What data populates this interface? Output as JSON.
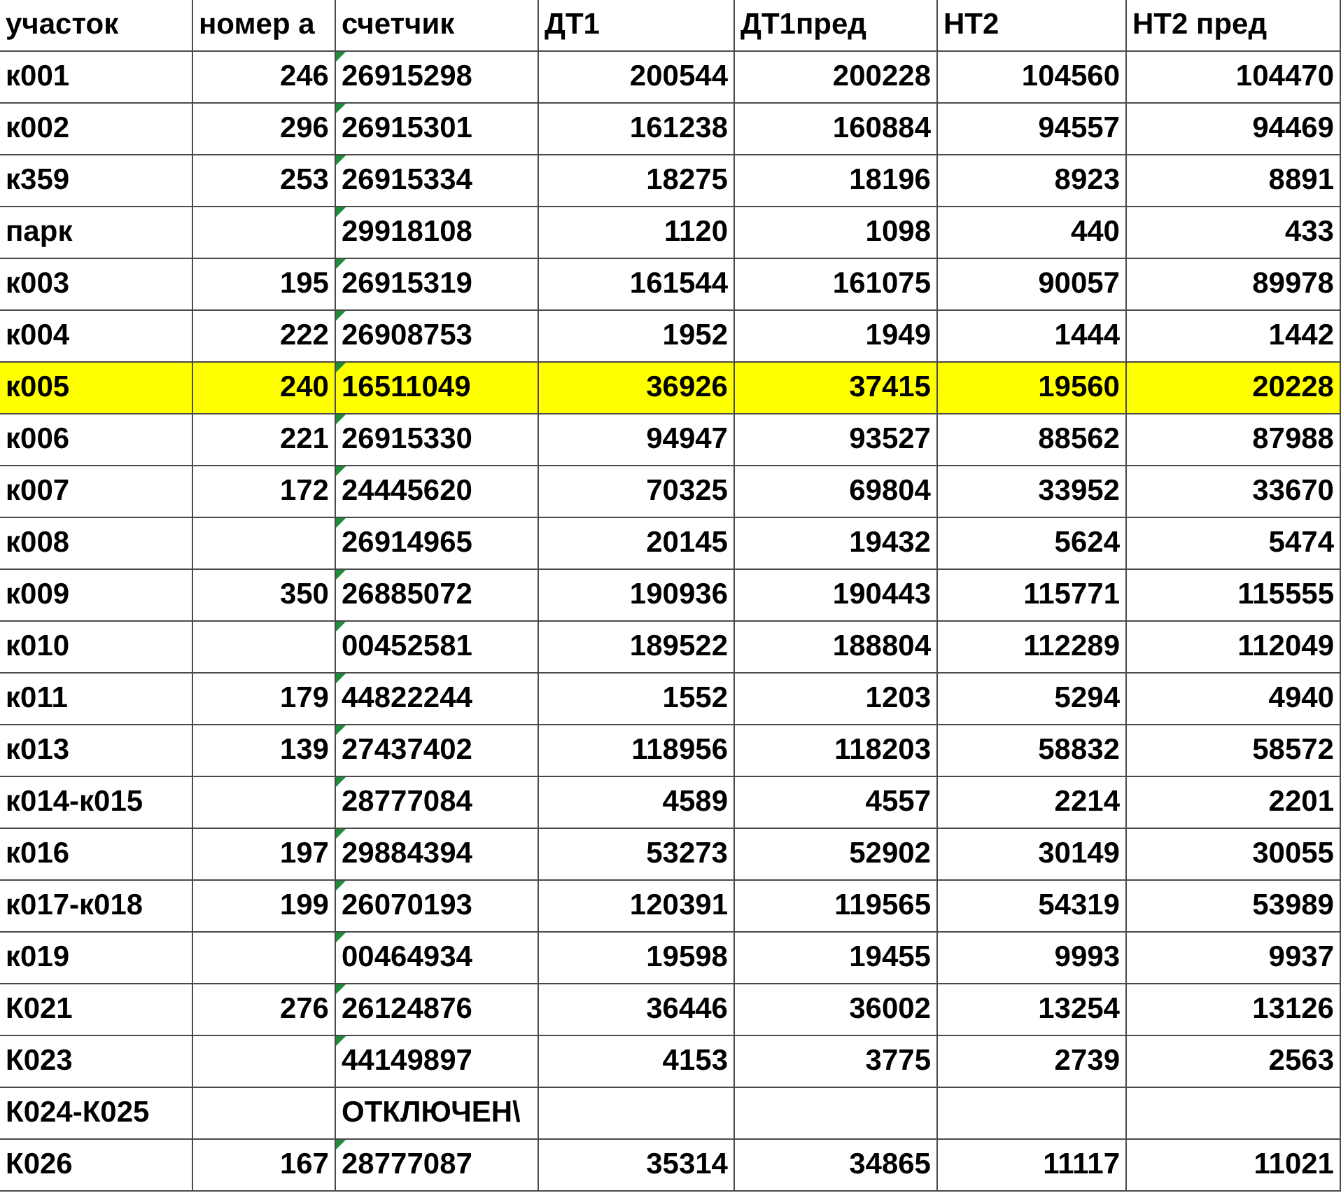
{
  "table": {
    "columns": [
      "участок",
      "номер а",
      "счетчик",
      "ДТ1",
      "ДТ1пред",
      "НТ2",
      "НТ2 пред"
    ],
    "rows": [
      {
        "plot": "к001",
        "number": "246",
        "meter": "26915298",
        "dt1": "200544",
        "dt1_prev": "200228",
        "nt2": "104560",
        "nt2_prev": "104470",
        "highlighted": false,
        "flagged": true
      },
      {
        "plot": "к002",
        "number": "296",
        "meter": "26915301",
        "dt1": "161238",
        "dt1_prev": "160884",
        "nt2": "94557",
        "nt2_prev": "94469",
        "highlighted": false,
        "flagged": true
      },
      {
        "plot": "к359",
        "number": "253",
        "meter": "26915334",
        "dt1": "18275",
        "dt1_prev": "18196",
        "nt2": "8923",
        "nt2_prev": "8891",
        "highlighted": false,
        "flagged": true
      },
      {
        "plot": "парк",
        "meter": "29918108",
        "dt1": "1120",
        "dt1_prev": "1098",
        "nt2": "440",
        "nt2_prev": "433",
        "highlighted": false,
        "flagged": true
      },
      {
        "plot": "к003",
        "number": "195",
        "meter": "26915319",
        "dt1": "161544",
        "dt1_prev": "161075",
        "nt2": "90057",
        "nt2_prev": "89978",
        "highlighted": false,
        "flagged": true
      },
      {
        "plot": "к004",
        "number": "222",
        "meter": "26908753",
        "dt1": "1952",
        "dt1_prev": "1949",
        "nt2": "1444",
        "nt2_prev": "1442",
        "highlighted": false,
        "flagged": true
      },
      {
        "plot": "к005",
        "number": "240",
        "meter": "16511049",
        "dt1": "36926",
        "dt1_prev": "37415",
        "nt2": "19560",
        "nt2_prev": "20228",
        "highlighted": true,
        "flagged": true
      },
      {
        "plot": "к006",
        "number": "221",
        "meter": "26915330",
        "dt1": "94947",
        "dt1_prev": "93527",
        "nt2": "88562",
        "nt2_prev": "87988",
        "highlighted": false,
        "flagged": true
      },
      {
        "plot": "к007",
        "number": "172",
        "meter": "24445620",
        "dt1": "70325",
        "dt1_prev": "69804",
        "nt2": "33952",
        "nt2_prev": "33670",
        "highlighted": false,
        "flagged": true
      },
      {
        "plot": "к008",
        "meter": "26914965",
        "dt1": "20145",
        "dt1_prev": "19432",
        "nt2": "5624",
        "nt2_prev": "5474",
        "highlighted": false,
        "flagged": true
      },
      {
        "plot": "к009",
        "number": "350",
        "meter": "26885072",
        "dt1": "190936",
        "dt1_prev": "190443",
        "nt2": "115771",
        "nt2_prev": "115555",
        "highlighted": false,
        "flagged": true
      },
      {
        "plot": "к010",
        "meter": "00452581",
        "dt1": "189522",
        "dt1_prev": "188804",
        "nt2": "112289",
        "nt2_prev": "112049",
        "highlighted": false,
        "flagged": true
      },
      {
        "plot": "к011",
        "number": "179",
        "meter": "44822244",
        "dt1": "1552",
        "dt1_prev": "1203",
        "nt2": "5294",
        "nt2_prev": "4940",
        "highlighted": false,
        "flagged": true
      },
      {
        "plot": "к013",
        "number": "139",
        "meter": "27437402",
        "dt1": "118956",
        "dt1_prev": "118203",
        "nt2": "58832",
        "nt2_prev": "58572",
        "highlighted": false,
        "flagged": true
      },
      {
        "plot": "к014-к015",
        "meter": "28777084",
        "dt1": "4589",
        "dt1_prev": "4557",
        "nt2": "2214",
        "nt2_prev": "2201",
        "highlighted": false,
        "flagged": true
      },
      {
        "plot": "к016",
        "number": "197",
        "meter": "29884394",
        "dt1": "53273",
        "dt1_prev": "52902",
        "nt2": "30149",
        "nt2_prev": "30055",
        "highlighted": false,
        "flagged": true
      },
      {
        "plot": "к017-к018",
        "number": "199",
        "meter": "26070193",
        "dt1": "120391",
        "dt1_prev": "119565",
        "nt2": "54319",
        "nt2_prev": "53989",
        "highlighted": false,
        "flagged": true
      },
      {
        "plot": "к019",
        "meter": "00464934",
        "dt1": "19598",
        "dt1_prev": "19455",
        "nt2": "9993",
        "nt2_prev": "9937",
        "highlighted": false,
        "flagged": true
      },
      {
        "plot": "К021",
        "number": "276",
        "meter": "26124876",
        "dt1": "36446",
        "dt1_prev": "36002",
        "nt2": "13254",
        "nt2_prev": "13126",
        "highlighted": false,
        "flagged": true
      },
      {
        "plot": "К023",
        "meter": "44149897",
        "dt1": "4153",
        "dt1_prev": "3775",
        "nt2": "2739",
        "nt2_prev": "2563",
        "highlighted": false,
        "flagged": true
      },
      {
        "plot": "К024-К025",
        "meter": "ОТКЛЮЧЕН\\",
        "highlighted": false,
        "flagged": false
      },
      {
        "plot": "К026",
        "number": "167",
        "meter": "28777087",
        "dt1": "35314",
        "dt1_prev": "34865",
        "nt2": "11117",
        "nt2_prev": "11021",
        "highlighted": false,
        "flagged": true
      }
    ]
  }
}
